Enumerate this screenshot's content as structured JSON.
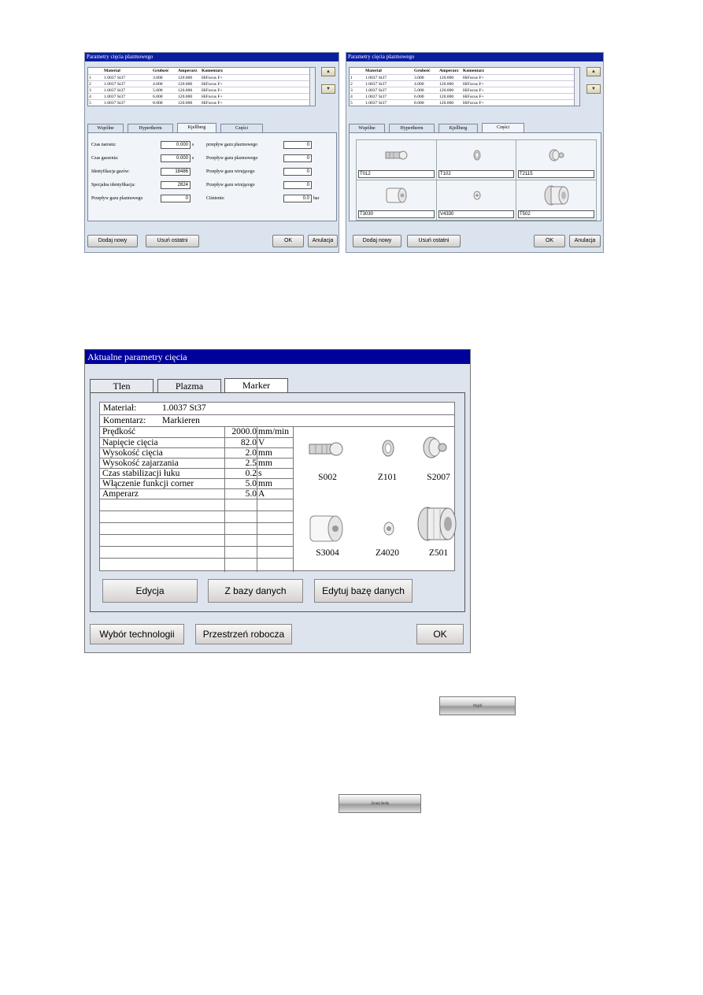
{
  "left_window": {
    "title": "Parametry cięcia plazmowego",
    "table_headers": [
      "Material",
      "Grubość",
      "Amperarz",
      "Komentarz"
    ],
    "table_rows": [
      {
        "n": "1",
        "material": "1.0037 St37",
        "grubosc": "3.000",
        "amperarz": "120.000",
        "komentarz": "HiFocus F+"
      },
      {
        "n": "2",
        "material": "1.0037 St37",
        "grubosc": "4.000",
        "amperarz": "120.000",
        "komentarz": "HiFocus F+"
      },
      {
        "n": "3",
        "material": "1.0037 St37",
        "grubosc": "5.000",
        "amperarz": "120.000",
        "komentarz": "HiFocus F+"
      },
      {
        "n": "4",
        "material": "1.0037 St37",
        "grubosc": "6.000",
        "amperarz": "120.000",
        "komentarz": "HiFocus F+"
      },
      {
        "n": "5",
        "material": "1.0037 St37",
        "grubosc": "8.000",
        "amperarz": "120.000",
        "komentarz": "HiFocus F+"
      }
    ],
    "up_button": "▲",
    "down_button": "▼",
    "tabs": [
      "Wspólne",
      "Hypertherm",
      "Kjellberg",
      "Części"
    ],
    "active_tab": "Kjellberg",
    "fields_left": [
      {
        "label": "Czas narostu:",
        "value": "0.000",
        "unit": "s"
      },
      {
        "label": "Czas gaszenia:",
        "value": "0.000",
        "unit": "s"
      },
      {
        "label": "Identyfikacja gazów:",
        "value": "18486",
        "unit": ""
      },
      {
        "label": "Specjalna identyfikacja:",
        "value": "2824",
        "unit": ""
      },
      {
        "label": "Przepływ gazu plazmowego",
        "value": "0",
        "unit": ""
      }
    ],
    "fields_right": [
      {
        "label": "przepływ gazu plazmowego",
        "value": "0",
        "unit": ""
      },
      {
        "label": "Przepływ gazu plazmowego",
        "value": "0",
        "unit": ""
      },
      {
        "label": "Przepływ gazu wirującego",
        "value": "0",
        "unit": ""
      },
      {
        "label": "Przepływ gazu wirującego",
        "value": "0",
        "unit": ""
      },
      {
        "label": "Ciśnienie:",
        "value": "0.0",
        "unit": "bar"
      }
    ],
    "buttons": {
      "add": "Dodaj nowy",
      "remove": "Usuń ostatni",
      "ok": "OK",
      "cancel": "Anulacja"
    }
  },
  "right_window": {
    "title": "Parametry cięcia plazmowego",
    "table_headers": [
      "Material",
      "Grubość",
      "Amperarz",
      "Komentarz"
    ],
    "table_rows": [
      {
        "n": "1",
        "material": "1.0037 St37",
        "grubosc": "3.000",
        "amperarz": "120.000",
        "komentarz": "HiFocus F+"
      },
      {
        "n": "2",
        "material": "1.0037 St37",
        "grubosc": "4.000",
        "amperarz": "120.000",
        "komentarz": "HiFocus F+"
      },
      {
        "n": "3",
        "material": "1.0037 St37",
        "grubosc": "5.000",
        "amperarz": "120.000",
        "komentarz": "HiFocus F+"
      },
      {
        "n": "4",
        "material": "1.0037 St37",
        "grubosc": "6.000",
        "amperarz": "120.000",
        "komentarz": "HiFocus F+"
      },
      {
        "n": "5",
        "material": "1.0037 St37",
        "grubosc": "8.000",
        "amperarz": "120.000",
        "komentarz": "HiFocus F+"
      }
    ],
    "up_button": "▲",
    "down_button": "▼",
    "tabs": [
      "Wspólne",
      "Hypertherm",
      "Kjellberg",
      "Części"
    ],
    "active_tab": "Części",
    "parts": [
      "T012",
      "T102",
      "T2115",
      "T3030",
      "V4330",
      "T502"
    ],
    "buttons": {
      "add": "Dodaj nowy",
      "remove": "Usuń ostatni",
      "ok": "OK",
      "cancel": "Anulacja"
    }
  },
  "main_window": {
    "title": "Aktualne parametry cięcia",
    "tabs": [
      "Tlen",
      "Plazma",
      "Marker"
    ],
    "active_tab": "Marker",
    "material_label": "Materiał:",
    "material_value": "1.0037 St37",
    "comment_label": "Komentarz:",
    "comment_value": "Markieren",
    "params": [
      {
        "name": "Prędkość",
        "value": "2000.0",
        "unit": "mm/min"
      },
      {
        "name": "Napięcie cięcia",
        "value": "82.0",
        "unit": "V"
      },
      {
        "name": "Wysokość cięcia",
        "value": "2.0",
        "unit": "mm"
      },
      {
        "name": "Wysokość zajarzania",
        "value": "2.5",
        "unit": "mm"
      },
      {
        "name": "Czas stabilizacji łuku",
        "value": "0.2",
        "unit": "s"
      },
      {
        "name": "Włączenie funkcji corner",
        "value": "5.0",
        "unit": "mm"
      },
      {
        "name": "Amperarz",
        "value": "5.0",
        "unit": "A"
      }
    ],
    "parts": [
      "S002",
      "Z101",
      "S2007",
      "S3004",
      "Z4020",
      "Z501"
    ],
    "buttons": {
      "edit": "Edycja",
      "from_db": "Z bazy danych",
      "edit_db": "Edytuj bazę danych",
      "tech": "Wybór technologii",
      "workspace": "Przestrzeń robocza",
      "ok": "OK"
    }
  },
  "mini_buttons": [
    {
      "label": "Wyjdź"
    },
    {
      "label": "Zmień Strefę"
    }
  ],
  "colors": {
    "titlebar": "#0b1ea0",
    "window_bg": "#dbe3ee",
    "main_titlebar": "#00009c"
  }
}
